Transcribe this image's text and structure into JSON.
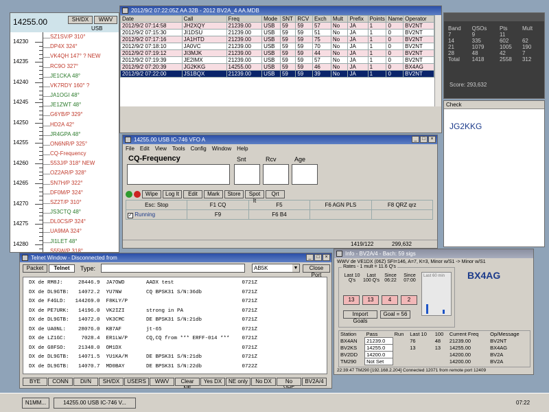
{
  "bandmap": {
    "freq": "14255.00",
    "btn_sh": "SH/DX",
    "btn_wwv": "WWV",
    "mode": "USB",
    "freq_labels": [
      "14230",
      "14235",
      "14240",
      "14245",
      "14250",
      "14255",
      "14260",
      "14265",
      "14270",
      "14275",
      "14280"
    ],
    "spots": [
      {
        "text": "SZ1SV/P 310°",
        "color": "#c0392b"
      },
      {
        "text": "DP4X 324°",
        "color": "#c0392b"
      },
      {
        "text": "VK4QH 147° ? NEW",
        "color": "#c0392b"
      },
      {
        "text": "RC9O 327°",
        "color": "#c0392b"
      },
      {
        "text": "JE1CKA 48°",
        "color": "#2a7a2a"
      },
      {
        "text": "VK7RDY 160° ?",
        "color": "#c0392b"
      },
      {
        "text": "JA1OGI 48°",
        "color": "#2a7a2a"
      },
      {
        "text": "JE1ZWT 48°",
        "color": "#2a7a2a"
      },
      {
        "text": "G6YB/P 329°",
        "color": "#c0392b"
      },
      {
        "text": "HD2A 42°",
        "color": "#c0392b"
      },
      {
        "text": "JR4GPA 48°",
        "color": "#2a7a2a"
      },
      {
        "text": "ON6NR/P 325°",
        "color": "#c0392b"
      },
      {
        "text": "CQ-Frequency",
        "color": "#c0392b"
      },
      {
        "text": "S53J/P 318° NEW",
        "color": "#c0392b"
      },
      {
        "text": "OZ2AR/P 328°",
        "color": "#c0392b"
      },
      {
        "text": "SN7H/P 322°",
        "color": "#c0392b"
      },
      {
        "text": "DF0M/P 324°",
        "color": "#c0392b"
      },
      {
        "text": "SZ2T/P 310°",
        "color": "#c0392b"
      },
      {
        "text": "JS3CTQ 48°",
        "color": "#2a7a2a"
      },
      {
        "text": "DL0CS/P 324°",
        "color": "#c0392b"
      },
      {
        "text": "UA9MA 324°",
        "color": "#c0392b"
      },
      {
        "text": "JI1LET 48°",
        "color": "#2a7a2a"
      },
      {
        "text": "S55W/P 318°",
        "color": "#c0392b"
      }
    ]
  },
  "log": {
    "title": "2012/9/2 07:22:05Z AA 32B - 2012 BV2A_4 AA.MDB",
    "columns": [
      "Date",
      "Call",
      "Freq",
      "Mode",
      "SNT",
      "RCV",
      "Exch",
      "Mult",
      "Prefix",
      "Points",
      "Name",
      "Operator"
    ],
    "rows": [
      [
        "2012/9/2 07:14:58",
        "JH2XQY",
        "21239.00",
        "USB",
        "59",
        "59",
        "57",
        "No",
        "JA",
        "1",
        "0",
        "BV2NT"
      ],
      [
        "2012/9/2 07:15:30",
        "JI1DSU",
        "21239.00",
        "USB",
        "59",
        "59",
        "51",
        "No",
        "JA",
        "1",
        "0",
        "BV2NT"
      ],
      [
        "2012/9/2 07:17:16",
        "JA1HTD",
        "21239.00",
        "USB",
        "59",
        "59",
        "75",
        "No",
        "JA",
        "1",
        "0",
        "BV2NT"
      ],
      [
        "2012/9/2 07:18:10",
        "JA0VC",
        "21239.00",
        "USB",
        "59",
        "59",
        "70",
        "No",
        "JA",
        "1",
        "0",
        "BV2NT"
      ],
      [
        "2012/9/2 07:19:12",
        "JI3MJK",
        "21239.00",
        "USB",
        "59",
        "59",
        "44",
        "No",
        "JA",
        "1",
        "0",
        "BV2NT"
      ],
      [
        "2012/9/2 07:19:39",
        "JE2IMX",
        "21239.00",
        "USB",
        "59",
        "59",
        "57",
        "No",
        "JA",
        "1",
        "0",
        "BV2NT"
      ],
      [
        "2012/9/2 07:20:39",
        "JG2KKG",
        "14255.00",
        "USB",
        "59",
        "59",
        "46",
        "No",
        "JA",
        "1",
        "0",
        "BX4AG"
      ],
      [
        "2012/9/2 07:22:00",
        "JS1BQX",
        "21239.00",
        "USB",
        "59",
        "59",
        "39",
        "No",
        "JA",
        "1",
        "0",
        "BV2NT"
      ]
    ]
  },
  "score": {
    "header": [
      "Band",
      "QSOs",
      "Pts",
      "Mult"
    ],
    "rows": [
      [
        "7",
        "9",
        "11",
        ""
      ],
      [
        "14",
        "335",
        "602",
        "62"
      ],
      [
        "21",
        "1079",
        "1005",
        "190"
      ],
      [
        "28",
        "48",
        "42",
        "7"
      ]
    ],
    "total_label": "Total",
    "total": [
      "1418",
      "2558",
      "312"
    ],
    "score_label": "Score:",
    "score_value": "293,632"
  },
  "check": {
    "title": "Check",
    "call": "JG2KKG"
  },
  "entry": {
    "title": "14255.00 USB IC-746 VFO A",
    "menu": [
      "File",
      "Edit",
      "View",
      "Tools",
      "Config",
      "Window",
      "Help"
    ],
    "call_label": "CQ-Frequency",
    "snt_label": "Snt",
    "rcv_label": "Rcv",
    "age_label": "Age",
    "buttons": [
      "Wipe",
      "Log It",
      "Edit",
      "Mark",
      "Store",
      "Spot It",
      "Qrt"
    ],
    "fkeys_row1": [
      "Esc: Stop",
      "F1 CQ",
      "F5",
      "F6 AGN PLS",
      "F8 QRZ qrz"
    ],
    "running_label": "Running",
    "fkeys_row2": [
      "F9",
      "F6 B4",
      "",
      ""
    ],
    "status_count": "1419/122",
    "status_score": "299,632"
  },
  "telnet": {
    "title": "Telnet Window - Disconnected from",
    "tab_packet": "Packet",
    "tab_telnet": "Telnet",
    "type_label": "Type:",
    "combo_value": "AB5K",
    "close_btn": "Close Port",
    "lines": [
      "DX de RM8J:     28446.9  JA7OWD       AADX test                      0721Z",
      "DX de DL9GTB:   14072.2  YU7NW        CQ BPSK31 S/N:36db             0721Z",
      "DX de F4GLD:   144269.0  F8KLY/P                                     0721Z",
      "DX de PE7URK:   14196.0  VK2IZI       strong in PA                   0721Z",
      "DX de DL9GTB:   14072.0  VK3CMC       DE BPSK31 S/N:21db             0721Z",
      "DX de UA0NL:    28076.0  KB7AF        jt-65                          0721Z",
      "DX de LZ1GC:     7028.4  ER1LW/P      CQ,CQ from *** ERFF-014 ***    0721Z",
      "DX de G8FSO:    21348.0  OM1DX                                       0721Z",
      "DX de DL9GTB:   14071.5  YU1KA/M      DE BPSK31 S/N:21db             0721Z",
      "DX de DL9GTB:   14070.7  MD0BAY       DE BPSK31 S/N:22db             0722Z"
    ],
    "bottom_buttons": [
      "BYE",
      "CONN",
      "DI/N",
      "SH/DX",
      "USERS",
      "WWV",
      "Clear NE",
      "Yes DX",
      "NE only",
      "No DX",
      "No VHF",
      "BV2A/4"
    ]
  },
  "info": {
    "title": "Info - BV2A/4 - Bach: 59 sigs",
    "wwv": "WWV de VE1DX (06Z)   SFI=146, A=7, K=3, Minor w/S1 -> Minor w/S1",
    "rates_label": "Rates - 1 mult = 11.6 Q's",
    "col_last10": "Last 10 Q's",
    "col_last100": "Last 100 Q's",
    "col_since1": "Since 06:22",
    "col_since2": "Since 07:00",
    "rate_values": [
      "13",
      "13",
      "4",
      "2"
    ],
    "last60_label": "Last 60 min",
    "import_btn": "Import Goals",
    "goal_btn": "Goal = 56",
    "big_call": "BX4AG",
    "station_header": [
      "Station",
      "Pass",
      "Run",
      "Last 10",
      "100",
      "Current Freq",
      "Op/Message"
    ],
    "stations": [
      [
        "BX4AN",
        "21239.0",
        "",
        "76",
        "48",
        "21239.00",
        "BV2NT"
      ],
      [
        "BV2KS",
        "14255.0",
        "",
        "13",
        "13",
        "14255.00",
        "BX4AG"
      ],
      [
        "BV2DD",
        "14200.0",
        "",
        "",
        "",
        "14200.00",
        "BV2A"
      ],
      [
        "TM290",
        "Not Set",
        "",
        "",
        "",
        "14200.00",
        "BV2A"
      ]
    ],
    "status": "22:39:47   TM290 [192.168.2.204] Connected 12071 from remote port 12409"
  },
  "taskbar": {
    "items": [
      "N1MM...",
      "14255.00 USB IC-746 V..."
    ],
    "clock": "07:22"
  },
  "colors": {
    "title_blue": "#2b4fa8",
    "selected_row": "#0a246a",
    "rate_red": "#f2b8b8",
    "spot_red": "#c0392b",
    "spot_green": "#2a7a2a"
  }
}
